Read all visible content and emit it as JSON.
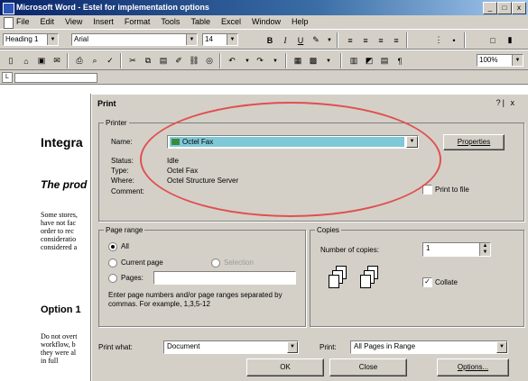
{
  "window": {
    "title": "Microsoft Word - Estel for implementation options"
  },
  "menu": [
    "File",
    "Edit",
    "View",
    "Insert",
    "Format",
    "Tools",
    "Table",
    "Excel",
    "Window",
    "Help"
  ],
  "toolbar1": {
    "style": "Heading 1",
    "font": "Arial",
    "size": "14"
  },
  "toolbar2": {
    "zoom": "100%"
  },
  "document": {
    "heading1": "Integra",
    "heading2": "The prod",
    "para1": [
      "Some stores,",
      "have not fac",
      "order to rec",
      "consideratio",
      "considered a"
    ],
    "heading3": "Option 1",
    "para2": [
      "Do not overt",
      "workflow, b",
      "they were al",
      "in full"
    ]
  },
  "dialog": {
    "title": "Print",
    "help": "?| x",
    "printer": {
      "group_label": "Printer",
      "name_label": "Name:",
      "name_value": "Octel Fax",
      "status_label": "Status:",
      "status_value": "Idle",
      "type_label": "Type:",
      "type_value": "Octel Fax",
      "where_label": "Where:",
      "where_value": "Octel Structure Server",
      "comment_label": "Comment:",
      "properties_button": "Properties",
      "print_to_file_label": "Print to file",
      "print_to_file_checked": false
    },
    "page_range": {
      "group_label": "Page range",
      "all_label": "All",
      "current_label": "Current page",
      "selection_label": "Selection",
      "pages_label": "Pages:",
      "pages_value": "",
      "hint": "Enter page numbers and/or page ranges separated by commas. For example, 1,3,5-12",
      "selected": "all"
    },
    "copies": {
      "group_label": "Copies",
      "number_label": "Number of copies:",
      "number_value": "1",
      "collate_label": "Collate",
      "collate_checked": true
    },
    "print_what_label": "Print what:",
    "print_what_value": "Document",
    "print_label": "Print:",
    "print_value": "All Pages in Range",
    "ok_button": "OK",
    "close_button": "Close",
    "options_button": "Options..."
  },
  "annotation_color": "#e05050"
}
